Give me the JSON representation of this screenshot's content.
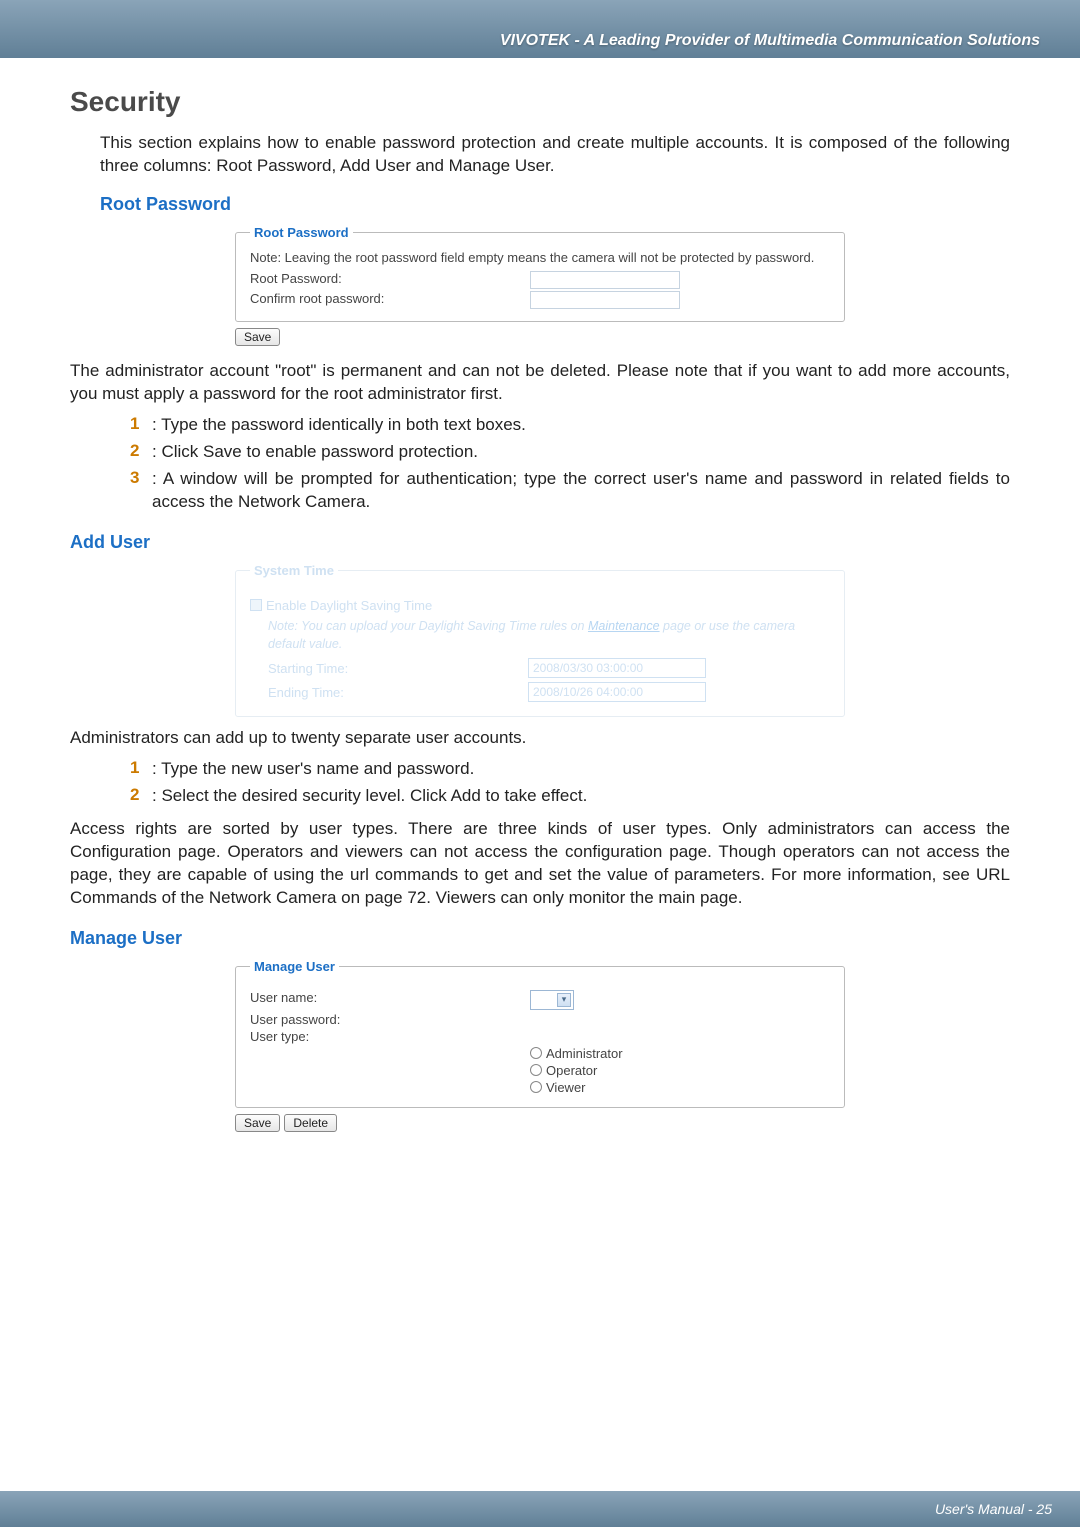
{
  "header": {
    "title": "VIVOTEK - A Leading Provider of Multimedia Communication Solutions"
  },
  "h_security": "Security",
  "intro": "This section explains how to enable password protection and create multiple accounts. It is composed of the following three columns: Root Password, Add User and Manage User.",
  "root_password": {
    "heading": "Root Password",
    "legend": "Root Password",
    "note": "Note: Leaving the root password field empty means the camera will not be protected by password.",
    "row1_label": "Root Password:",
    "row2_label": "Confirm root password:",
    "save_btn": "Save"
  },
  "root_after": "The administrator account \"root\" is permanent and can not be deleted. Please note that if you want to add more accounts, you must apply a password for the root administrator first.",
  "root_steps": {
    "s1": ": Type the password identically in both text boxes.",
    "s2": ": Click Save to enable password protection.",
    "s3": ": A window will be prompted for authentication; type the correct user's name and password in related fields to access the Network Camera."
  },
  "add_user": {
    "heading": "Add User",
    "faded": {
      "legend": "System Time",
      "checkbox": "Enable Daylight Saving Time",
      "note_pre": "Note: You can upload your Daylight Saving Time rules on ",
      "note_link": "Maintenance",
      "note_post": " page or use the camera default value.",
      "row1_label": "Starting Time:",
      "row1_value": "2008/03/30 03:00:00",
      "row2_label": "Ending Time:",
      "row2_value": "2008/10/26 04:00:00"
    },
    "after": "Administrators can add up to twenty separate user accounts.",
    "steps": {
      "s1": ": Type the new user's name and password.",
      "s2": ": Select the desired security level. Click Add to take effect."
    },
    "para": "Access rights are sorted by user types. There are three kinds of user types. Only administrators can access the Configuration page. Operators and viewers can not access the configuration page. Though operators can not access the page, they are capable of using the url commands to get and set the value of parameters. For more information, see URL Commands of the Network Camera on page 72. Viewers can only monitor the main page."
  },
  "manage_user": {
    "heading": "Manage User",
    "legend": "Manage User",
    "row1": "User name:",
    "row2": "User password:",
    "row3": "User type:",
    "radios": {
      "r1": "Administrator",
      "r2": "Operator",
      "r3": "Viewer"
    },
    "save_btn": "Save",
    "delete_btn": "Delete"
  },
  "footer": {
    "text": "User's Manual - 25"
  },
  "nums": {
    "n1": "1",
    "n2": "2",
    "n3": "3"
  }
}
